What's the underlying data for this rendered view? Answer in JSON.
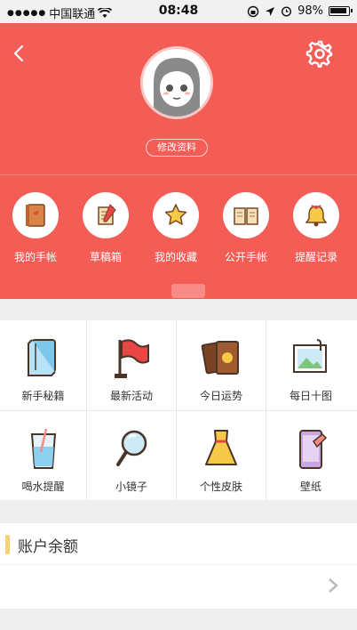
{
  "status_bar": {
    "carrier": "中国联通",
    "time": "08:48",
    "battery": "98%"
  },
  "header": {
    "edit_profile": "修改资料",
    "quick_actions": [
      {
        "label": "我的手帐",
        "icon": "notebook-icon"
      },
      {
        "label": "草稿箱",
        "icon": "scroll-icon"
      },
      {
        "label": "我的收藏",
        "icon": "star-icon"
      },
      {
        "label": "公开手帐",
        "icon": "open-book-icon"
      },
      {
        "label": "提醒记录",
        "icon": "bell-icon"
      }
    ]
  },
  "features": [
    {
      "label": "新手秘籍",
      "icon": "guide-book-icon"
    },
    {
      "label": "最新活动",
      "icon": "flag-icon"
    },
    {
      "label": "今日运势",
      "icon": "tarot-card-icon"
    },
    {
      "label": "每日十图",
      "icon": "photo-icon"
    },
    {
      "label": "喝水提醒",
      "icon": "water-glass-icon"
    },
    {
      "label": "小镜子",
      "icon": "mirror-icon"
    },
    {
      "label": "个性皮肤",
      "icon": "dress-icon"
    },
    {
      "label": "壁纸",
      "icon": "phone-wallpaper-icon"
    }
  ],
  "account": {
    "title": "账户余额"
  },
  "colors": {
    "header_bg": "#f45d56",
    "accent_bar": "#f5d370"
  }
}
